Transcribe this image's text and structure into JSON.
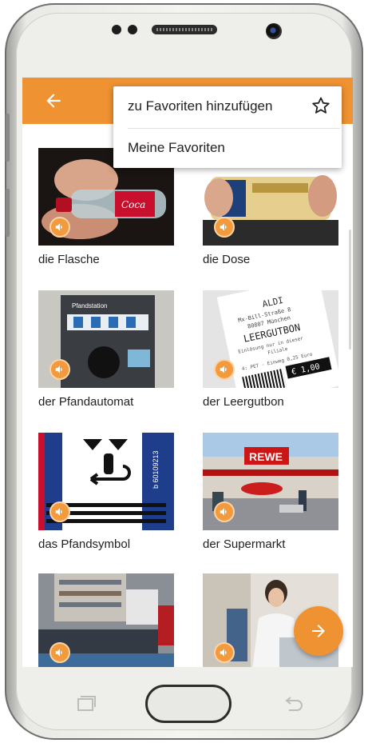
{
  "menu": {
    "add_favorite": "zu Favoriten hinzufügen",
    "my_favorites": "Meine Favoriten"
  },
  "cards": [
    {
      "caption": "die Flasche",
      "image": "plastic-bottle-photo"
    },
    {
      "caption": "die Dose",
      "image": "beer-can-photo"
    },
    {
      "caption": "der Pfandautomat",
      "image": "deposit-machine-photo"
    },
    {
      "caption": "der Leergutbon",
      "image": "deposit-receipt-photo"
    },
    {
      "caption": "das Pfandsymbol",
      "image": "deposit-symbol-photo"
    },
    {
      "caption": "der Supermarkt",
      "image": "supermarket-photo"
    },
    {
      "caption": "",
      "image": "checkout-conveyor-photo"
    },
    {
      "caption": "",
      "image": "cashier-photo"
    }
  ],
  "thumb_text": {
    "pfandstation": "Pfandstation",
    "receipt_aldi": "ALDI",
    "receipt_street": "Mx-Bill-Straße 8",
    "receipt_city": "80807 München",
    "receipt_title": "LEERGUTBON",
    "receipt_line1": "Einlösung nur in dieser",
    "receipt_line2": "Filiale",
    "receipt_line3": "4: PET - Einweg 0,25 Euro",
    "receipt_amount": "€ 1,00",
    "symbol_code": "b 60109213",
    "rewe": "REWE"
  },
  "colors": {
    "accent": "#ef9232",
    "speaker_badge": "#f39a3c"
  },
  "icons": {
    "back": "arrow-left-icon",
    "star": "star-outline-icon",
    "speaker": "volume-icon",
    "fab": "arrow-right-icon"
  }
}
